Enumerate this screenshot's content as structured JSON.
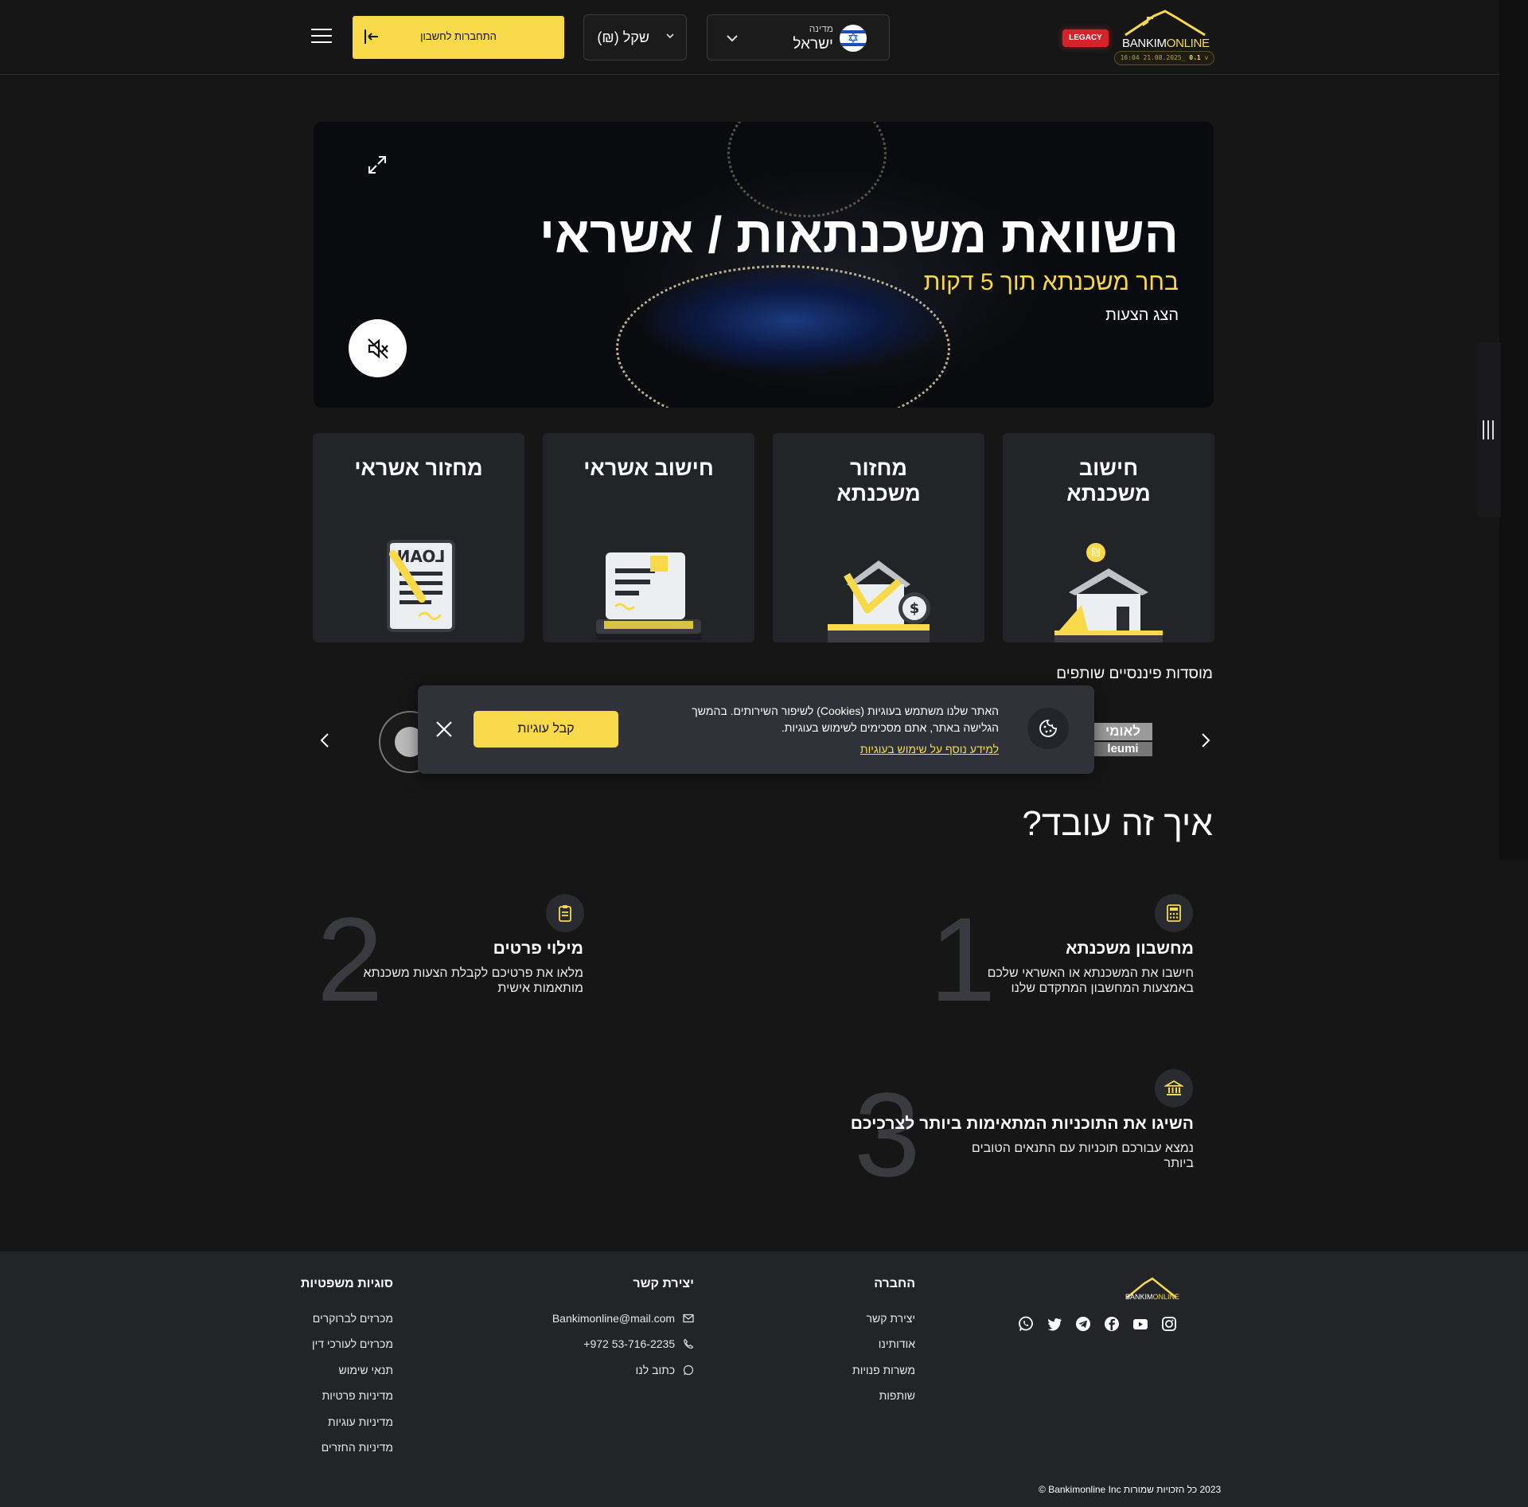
{
  "header": {
    "logo_prefix": "BANKIM",
    "logo_suffix": "ONLINE",
    "version_text": "16:04 21.08.2025_",
    "version_num": "0.1",
    "version_suffix": "v",
    "legacy_badge": "LEGACY",
    "country_label": "מדינה",
    "country_value": "ישראל",
    "currency_value": "(₪) שקל",
    "login_label": "התחברות לחשבון"
  },
  "hero": {
    "title": "השוואת משכנתאות / אשראי",
    "subtitle": "בחר משכנתא תוך 5 דקות",
    "link": "הצג הצעות"
  },
  "services": [
    {
      "title": "חישוב משכנתא"
    },
    {
      "title": "מחזור משכנתא"
    },
    {
      "title": "חישוב אשראי"
    },
    {
      "title": "מחזור אשראי"
    }
  ],
  "partners": {
    "title": "מוסדות פיננסיים שותפים",
    "leumi_he": "לאומי",
    "leumi_en": "leumi"
  },
  "cookie": {
    "text": "האתר שלנו משתמש בעוגיות (Cookies) לשיפור השירותים. בהמשך הגלישה באתר, אתם מסכימים לשימוש בעוגיות.",
    "link": "למידע נוסף על שימוש בעוגיות",
    "accept": "קבל עוגיות"
  },
  "how": {
    "title": "איך זה עובד?",
    "steps": [
      {
        "num": "1",
        "title": "מחשבון משכנתא",
        "desc": "חישבו את המשכנתא או האשראי שלכם באמצעות המחשבון המתקדם שלנו",
        "icon": "calculator-icon"
      },
      {
        "num": "2",
        "title": "מילוי פרטים",
        "desc": "מלאו את פרטיכם לקבלת הצעות משכנתא מותאמות אישית",
        "icon": "clipboard-icon"
      },
      {
        "num": "3",
        "title": "השיגו את התוכניות המתאימות ביותר לצרכיכם",
        "desc": "נמצא עבורכם תוכניות עם התנאים הטובים ביותר",
        "icon": "bank-icon"
      }
    ]
  },
  "footer": {
    "company_title": "החברה",
    "company_items": [
      "יצירת קשר",
      "אודותינו",
      "משרות פנויות",
      "שותפות"
    ],
    "contact_title": "יצירת קשר",
    "contact_email": "Bankimonline@mail.com",
    "contact_phone": "+972 53-716-2235",
    "contact_write": "כתוב לנו",
    "legal_title": "סוגיות משפטיות",
    "legal_items": [
      "מכרזים לברוקרים",
      "מכרזים לעורכי דין",
      "תנאי שימוש",
      "מדיניות פרטיות",
      "מדיניות עוגיות",
      "מדיניות החזרים"
    ],
    "copyright": "2023 כל הזכויות שמורות Bankimonline Inc ©",
    "social": [
      "instagram-icon",
      "youtube-icon",
      "facebook-icon",
      "telegram-icon",
      "twitter-icon",
      "whatsapp-icon"
    ]
  },
  "colors": {
    "accent": "#f7d94a",
    "background": "#161616",
    "card": "#232428",
    "legacy": "#d5232a"
  }
}
